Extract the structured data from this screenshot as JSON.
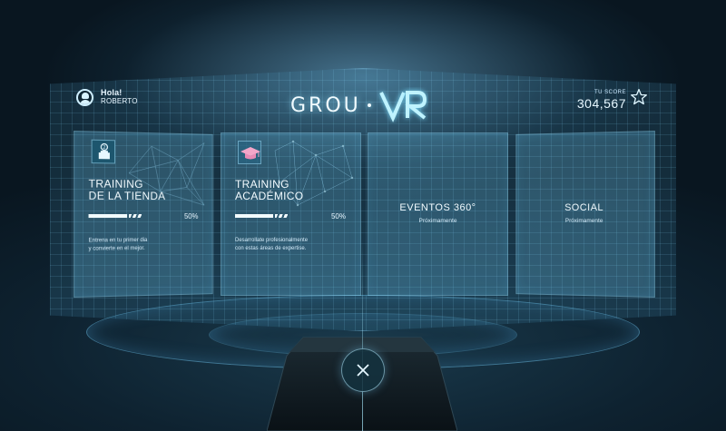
{
  "header": {
    "greeting": "Hola!",
    "user_name": "ROBERTO",
    "logo_left": "GROU",
    "logo_right": "VR",
    "score_label": "TU SCORE",
    "score_value": "304,567"
  },
  "cards": [
    {
      "title_line1": "TRAINING",
      "title_line2": "DE LA TIENDA",
      "progress_percent": 50,
      "progress_label": "50%",
      "desc_line1": "Entrena en tu primer dia",
      "desc_line2": "y convierte en el mejor.",
      "icon": "store-badge-icon"
    },
    {
      "title_line1": "TRAINING",
      "title_line2": "ACADÉMICO",
      "progress_percent": 50,
      "progress_label": "50%",
      "desc_line1": "Desarrollate profesionalmente",
      "desc_line2": "con estas áreas de expertise.",
      "icon": "graduation-cap-icon"
    },
    {
      "title": "EVENTOS 360°",
      "subtitle": "Próximamente"
    },
    {
      "title": "SOCIAL",
      "subtitle": "Próximamente"
    }
  ],
  "controls": {
    "close_icon": "close-icon"
  },
  "colors": {
    "accent": "#9fe8ff",
    "background": "#0b1822",
    "cap_pink": "#f4a6c9"
  }
}
